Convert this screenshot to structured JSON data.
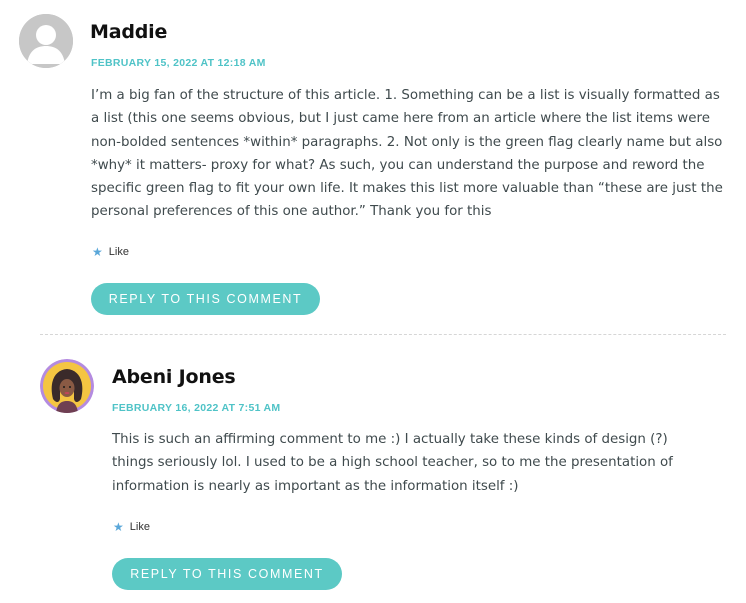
{
  "comments": [
    {
      "author": "Maddie",
      "date": "FEBRUARY 15, 2022 AT 12:18 AM",
      "avatar_icon": "default-person-icon",
      "text": "I’m a big fan of the structure of this article. 1. Something can be a list is visually formatted as a list (this one seems obvious, but I just came here from an article where the list items were non-bolded sentences *within* paragraphs. 2. Not only is the green flag clearly name but also *why* it matters- proxy for what? As such, you can understand the purpose and reword the specific green flag to fit your own life. It makes this list more valuable than “these are just the personal preferences of this one author.” Thank you for this",
      "like_label": "Like",
      "reply_label": "REPLY TO THIS COMMENT"
    },
    {
      "author": "Abeni Jones",
      "date": "FEBRUARY 16, 2022 AT 7:51 AM",
      "avatar_icon": "illustrated-portrait-icon",
      "text": "This is such an affirming comment to me :) I actually take these kinds of design (?) things seriously lol. I used to be a high school teacher, so to me the presentation of information is nearly as important as the information itself :)",
      "like_label": "Like",
      "reply_label": "REPLY TO THIS COMMENT"
    }
  ],
  "colors": {
    "accent": "#5cc9c5",
    "date": "#4fc3c7",
    "star": "#5aa7d9",
    "avatar_ring": "#b48be0"
  }
}
